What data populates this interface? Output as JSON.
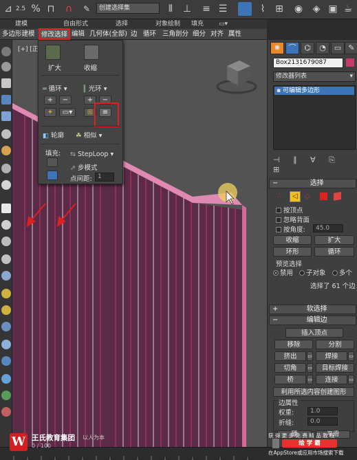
{
  "toolbar": {
    "selection_set_placeholder": "创建选择集",
    "angle_snap_value": "2.5",
    "percent_snap_label": "%"
  },
  "ribbon": {
    "tabs": [
      "建模",
      "自由形式",
      "选择",
      "对象绘制",
      "填充"
    ],
    "subtabs": [
      "多边形建模",
      "修改选择",
      "编辑",
      "几何体(全部)",
      "边",
      "循环",
      "三角剖分",
      "细分",
      "对齐",
      "属性"
    ]
  },
  "viewport": {
    "label": "[+] [正"
  },
  "float_panel": {
    "grow_label": "扩大",
    "shrink_label": "收缩",
    "loop_label": "循环",
    "ring_label": "光环",
    "outline_label": "轮廓",
    "similar_label": "相似",
    "fill_label": "填充:",
    "steploop_label": "StepLoop",
    "stepmode_label": "步模式",
    "point_distance_label": "点间距:",
    "point_distance_value": "1"
  },
  "command_panel": {
    "object_name": "Box2131679087",
    "modifier_list_label": "修改器列表",
    "stack_item": "可编辑多边形",
    "selection_header": "选择",
    "by_vertex": "按顶点",
    "ignore_backfacing": "忽略背面",
    "by_angle": "按角度:",
    "angle_value": "45.0",
    "shrink_btn": "收缩",
    "grow_btn": "扩大",
    "ring_btn": "环形",
    "loop_btn": "循环",
    "preview_selection": "预览选择",
    "disable": "禁用",
    "subobject": "子对象",
    "multi": "多个",
    "selected_count": "选择了 61 个边",
    "soft_selection": "软选择",
    "edit_edges": "编辑边",
    "insert_vertex": "插入顶点",
    "remove": "移除",
    "split": "分割",
    "extrude": "挤出",
    "weld": "焊接",
    "chamfer": "切角",
    "target_weld": "目标焊接",
    "bridge": "桥",
    "connect": "连接",
    "create_shape": "利用所选内容创建图形",
    "edge_properties": "边属性",
    "weight": "权重:",
    "weight_value": "1.0",
    "crease": "折缝:",
    "crease_value": "0.0",
    "hard": "硬",
    "smooth": "平滑"
  },
  "watermark": {
    "brand": "王氏教育集团",
    "tagline": "以人为本",
    "progress": "0 / 100",
    "logo_letter": "W",
    "right_line1": "获 得 更 多 免 费 精 品 教 程",
    "right_brand": "绘 学 霸",
    "right_line2": "在AppStore或应用市场搜索下载"
  },
  "colors": {
    "accent_blue": "#3d74b8",
    "highlight_red": "#e02020",
    "mesh_fill": "#5a2a47",
    "mesh_edge": "#c23a6a",
    "top_edge_pink": "#e08ab3"
  }
}
